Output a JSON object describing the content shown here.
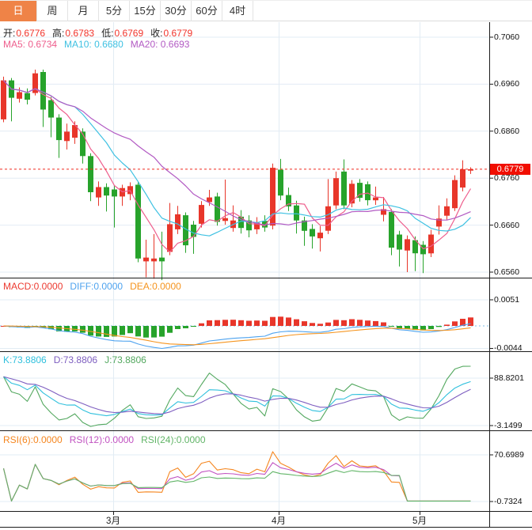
{
  "tabs": [
    {
      "label": "日",
      "active": true
    },
    {
      "label": "周",
      "active": false
    },
    {
      "label": "月",
      "active": false
    },
    {
      "label": "5分",
      "active": false
    },
    {
      "label": "15分",
      "active": false
    },
    {
      "label": "30分",
      "active": false
    },
    {
      "label": "60分",
      "active": false
    },
    {
      "label": "4时",
      "active": false
    }
  ],
  "legends": {
    "ohlc": [
      {
        "name": "open",
        "label": "开:",
        "value": "0.6776"
      },
      {
        "name": "high",
        "label": "高:",
        "value": "0.6783"
      },
      {
        "name": "low",
        "label": "低:",
        "value": "0.6769"
      },
      {
        "name": "close",
        "label": "收:",
        "value": "0.6779"
      }
    ],
    "ma": [
      {
        "name": "ma5",
        "text": "MA5: 0.6734",
        "color": "#ee5d8c"
      },
      {
        "name": "ma10",
        "text": "MA10: 0.6680",
        "color": "#3ec1e2"
      },
      {
        "name": "ma20",
        "text": "MA20: 0.6693",
        "color": "#b25ac3"
      }
    ],
    "macd": [
      {
        "name": "macd",
        "text": "MACD:0.0000",
        "color": "#ec3a30"
      },
      {
        "name": "diff",
        "text": "DIFF:0.0000",
        "color": "#4ea3ef"
      },
      {
        "name": "dea",
        "text": "DEA:0.0000",
        "color": "#f5941e"
      }
    ],
    "kdj": [
      {
        "name": "k",
        "text": "K:73.8806",
        "color": "#2fc0dd"
      },
      {
        "name": "d",
        "text": "D:73.8806",
        "color": "#7e5ec0"
      },
      {
        "name": "j",
        "text": "J:73.8806",
        "color": "#53a85f"
      }
    ],
    "rsi": [
      {
        "name": "rsi6",
        "text": "RSI(6):0.0000",
        "color": "#f5861f"
      },
      {
        "name": "rsi12",
        "text": "RSI(12):0.0000",
        "color": "#c152c1"
      },
      {
        "name": "rsi24",
        "text": "RSI(24):0.0000",
        "color": "#62b568"
      }
    ]
  },
  "axis": {
    "main_ticks": [
      {
        "label": "0.7060",
        "value": 0.706
      },
      {
        "label": "0.6960",
        "value": 0.696
      },
      {
        "label": "0.6860",
        "value": 0.686
      },
      {
        "label": "0.6760",
        "value": 0.676
      },
      {
        "label": "0.6660",
        "value": 0.666
      },
      {
        "label": "0.6560",
        "value": 0.656
      }
    ],
    "macd_ticks": [
      {
        "label": "0.0051",
        "value": 0.0051
      },
      {
        "label": "-0.0044",
        "value": -0.0044
      }
    ],
    "kdj_ticks": [
      {
        "label": "88.8201",
        "value": 88.8201
      },
      {
        "label": "-3.1499",
        "value": -3.1499
      }
    ],
    "rsi_ticks": [
      {
        "label": "70.6989",
        "value": 70.6989
      },
      {
        "label": "-0.7324",
        "value": -0.7324
      }
    ],
    "x_ticks": [
      {
        "label": "3月",
        "x": 143
      },
      {
        "label": "4月",
        "x": 352
      },
      {
        "label": "5月",
        "x": 530
      }
    ]
  },
  "chart_data": {
    "type": "candlestick",
    "title": "Daily candlestick chart with MACD, KDJ and RSI panels",
    "current_price": 0.6779,
    "current_price_label": "0.6779",
    "last_ohlc": {
      "open": 0.6776,
      "high": 0.6783,
      "low": 0.6769,
      "close": 0.6779
    },
    "ma_values": {
      "ma5": 0.6734,
      "ma10": 0.668,
      "ma20": 0.6693
    },
    "kdj_values": {
      "k": 73.8806,
      "d": 73.8806,
      "j": 73.8806
    },
    "candles": [
      [
        0.6885,
        0.6976,
        0.6879,
        0.6968
      ],
      [
        0.6968,
        0.6973,
        0.6881,
        0.6931
      ],
      [
        0.6929,
        0.6953,
        0.6921,
        0.6943
      ],
      [
        0.6941,
        0.6951,
        0.6917,
        0.6927
      ],
      [
        0.6941,
        0.6991,
        0.6936,
        0.6983
      ],
      [
        0.6986,
        0.6991,
        0.6869,
        0.6906
      ],
      [
        0.6926,
        0.6933,
        0.6847,
        0.6889
      ],
      [
        0.6889,
        0.6896,
        0.6803,
        0.6841
      ],
      [
        0.6839,
        0.6876,
        0.6821,
        0.6859
      ],
      [
        0.6846,
        0.6881,
        0.6833,
        0.6873
      ],
      [
        0.6859,
        0.6866,
        0.6791,
        0.6807
      ],
      [
        0.6807,
        0.6813,
        0.6711,
        0.673
      ],
      [
        0.6719,
        0.6753,
        0.6701,
        0.6741
      ],
      [
        0.6741,
        0.6749,
        0.6689,
        0.6723
      ],
      [
        0.6736,
        0.6743,
        0.6655,
        0.6721
      ],
      [
        0.6721,
        0.6746,
        0.6701,
        0.6739
      ],
      [
        0.6726,
        0.6751,
        0.6713,
        0.6743
      ],
      [
        0.6746,
        0.6751,
        0.6581,
        0.6589
      ],
      [
        0.6583,
        0.6629,
        0.6549,
        0.6591
      ],
      [
        0.6583,
        0.6641,
        0.6546,
        0.6589
      ],
      [
        0.6591,
        0.6646,
        0.6543,
        0.6583
      ],
      [
        0.6603,
        0.6707,
        0.6596,
        0.6662
      ],
      [
        0.6651,
        0.6701,
        0.6641,
        0.6683
      ],
      [
        0.6681,
        0.6687,
        0.6601,
        0.6617
      ],
      [
        0.6661,
        0.6669,
        0.6599,
        0.6635
      ],
      [
        0.6663,
        0.6711,
        0.6655,
        0.6703
      ],
      [
        0.6709,
        0.6735,
        0.6701,
        0.6719
      ],
      [
        0.6721,
        0.6729,
        0.6659,
        0.6667
      ],
      [
        0.6669,
        0.6757,
        0.6661,
        0.6675
      ],
      [
        0.6654,
        0.6702,
        0.6646,
        0.667
      ],
      [
        0.6678,
        0.6692,
        0.6642,
        0.6654
      ],
      [
        0.667,
        0.6681,
        0.6634,
        0.6649
      ],
      [
        0.6651,
        0.6677,
        0.6641,
        0.6665
      ],
      [
        0.6669,
        0.6681,
        0.6646,
        0.6655
      ],
      [
        0.6659,
        0.6791,
        0.6651,
        0.6782
      ],
      [
        0.6778,
        0.6801,
        0.6713,
        0.6723
      ],
      [
        0.6724,
        0.674,
        0.669,
        0.67
      ],
      [
        0.6702,
        0.6712,
        0.6642,
        0.667
      ],
      [
        0.667,
        0.6678,
        0.6616,
        0.6648
      ],
      [
        0.6652,
        0.6662,
        0.661,
        0.6636
      ],
      [
        0.6632,
        0.6658,
        0.6604,
        0.6644
      ],
      [
        0.6648,
        0.6758,
        0.6641,
        0.67
      ],
      [
        0.6702,
        0.6774,
        0.6694,
        0.676
      ],
      [
        0.6774,
        0.68,
        0.6694,
        0.6702
      ],
      [
        0.6706,
        0.6756,
        0.6698,
        0.6748
      ],
      [
        0.675,
        0.6758,
        0.671,
        0.6718
      ],
      [
        0.6747,
        0.6753,
        0.6702,
        0.6713
      ],
      [
        0.6713,
        0.6742,
        0.6703,
        0.6719
      ],
      [
        0.6682,
        0.672,
        0.6668,
        0.6694
      ],
      [
        0.6688,
        0.6694,
        0.6596,
        0.6612
      ],
      [
        0.664,
        0.6648,
        0.6572,
        0.6608
      ],
      [
        0.6606,
        0.6638,
        0.656,
        0.663
      ],
      [
        0.6628,
        0.6636,
        0.6562,
        0.66
      ],
      [
        0.6618,
        0.6626,
        0.6558,
        0.6598
      ],
      [
        0.66,
        0.665,
        0.6592,
        0.664
      ],
      [
        0.6657,
        0.6702,
        0.664,
        0.6674
      ],
      [
        0.668,
        0.6717,
        0.6672,
        0.67
      ],
      [
        0.6696,
        0.6766,
        0.669,
        0.6756
      ],
      [
        0.674,
        0.6798,
        0.6732,
        0.6779
      ],
      [
        0.6776,
        0.6783,
        0.6769,
        0.6779
      ]
    ],
    "indicators": {
      "ma_periods": [
        5,
        10,
        20
      ],
      "macd_params": [
        12,
        26,
        9
      ],
      "kdj_params": [
        9,
        3,
        3
      ],
      "rsi_periods": [
        6,
        12,
        24
      ],
      "rsi_flat_from_index": 51,
      "rsi_flat_value": 0
    },
    "panels": {
      "main_range": [
        0.656,
        0.706
      ],
      "macd_range": [
        -0.0044,
        0.0051
      ],
      "kdj_range": [
        -3.1499,
        88.8201
      ],
      "rsi_range": [
        -0.7324,
        70.6989
      ]
    },
    "legend_position": "top-left",
    "grid": true
  },
  "colors": {
    "up": "#e8362a",
    "down": "#27a32b",
    "text_red": "#f1342b",
    "tab_active_bg": "#ef8347",
    "badge_bg": "#f10e00",
    "grid": "#e2ecf4",
    "panel_border": "#1b1b1b",
    "zero_dotted": "#7fbfe8",
    "price_dotted": "#f02a1e",
    "ma5": "#ee5d8c",
    "ma10": "#3ec1e2",
    "ma20": "#b25ac3",
    "diff": "#4ea3ef",
    "dea": "#f5941e",
    "k": "#2fc0dd",
    "d": "#7e5ec0",
    "j": "#53a85f",
    "rsi6": "#f5861f",
    "rsi12": "#c152c1",
    "rsi24": "#62b568"
  }
}
